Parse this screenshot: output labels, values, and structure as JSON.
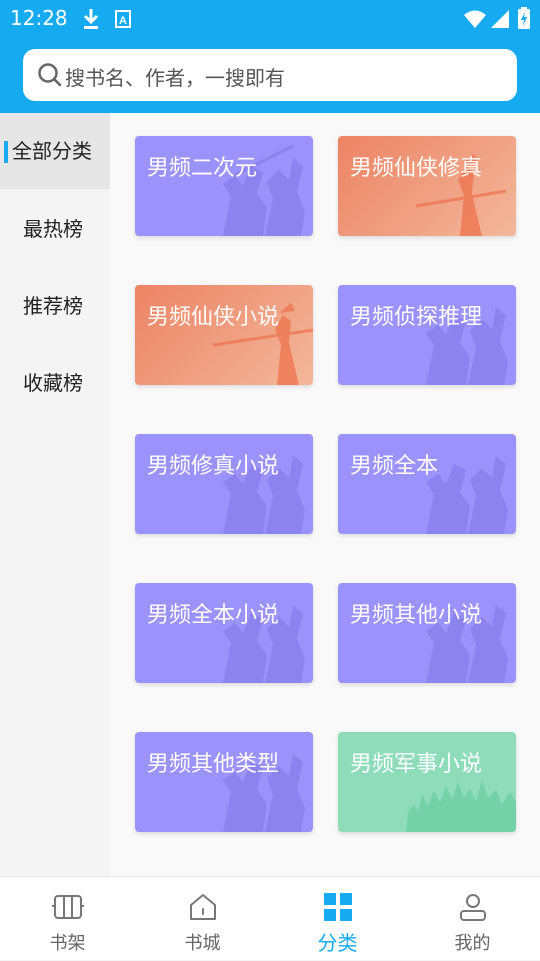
{
  "status_bar": {
    "time": "12:28",
    "icons": [
      "download-icon",
      "font-icon",
      "wifi-icon",
      "signal-icon",
      "battery-icon"
    ]
  },
  "search": {
    "placeholder": "搜书名、作者，一搜即有",
    "icon": "search-icon"
  },
  "sidebar": {
    "items": [
      {
        "label": "全部分类",
        "active": true
      },
      {
        "label": "最热榜",
        "active": false
      },
      {
        "label": "推荐榜",
        "active": false
      },
      {
        "label": "收藏榜",
        "active": false
      }
    ]
  },
  "categories": [
    {
      "label": "男频二次元",
      "style": "purple"
    },
    {
      "label": "男频仙侠修真",
      "style": "orange"
    },
    {
      "label": "男频仙侠小说",
      "style": "orange"
    },
    {
      "label": "男频侦探推理",
      "style": "purple"
    },
    {
      "label": "男频修真小说",
      "style": "purple"
    },
    {
      "label": "男频全本",
      "style": "purple"
    },
    {
      "label": "男频全本小说",
      "style": "purple"
    },
    {
      "label": "男频其他小说",
      "style": "purple"
    },
    {
      "label": "男频其他类型",
      "style": "purple"
    },
    {
      "label": "男频军事小说",
      "style": "green"
    }
  ],
  "tabbar": {
    "tabs": [
      {
        "label": "书架",
        "icon": "bookshelf-icon",
        "active": false
      },
      {
        "label": "书城",
        "icon": "home-icon",
        "active": false
      },
      {
        "label": "分类",
        "icon": "category-icon",
        "active": true
      },
      {
        "label": "我的",
        "icon": "profile-icon",
        "active": false
      }
    ]
  },
  "colors": {
    "accent": "#16aaf1",
    "card_purple": "#9b92fb",
    "card_orange_start": "#ec8464",
    "card_orange_end": "#f3b79b",
    "card_green": "#8fdcbb"
  }
}
